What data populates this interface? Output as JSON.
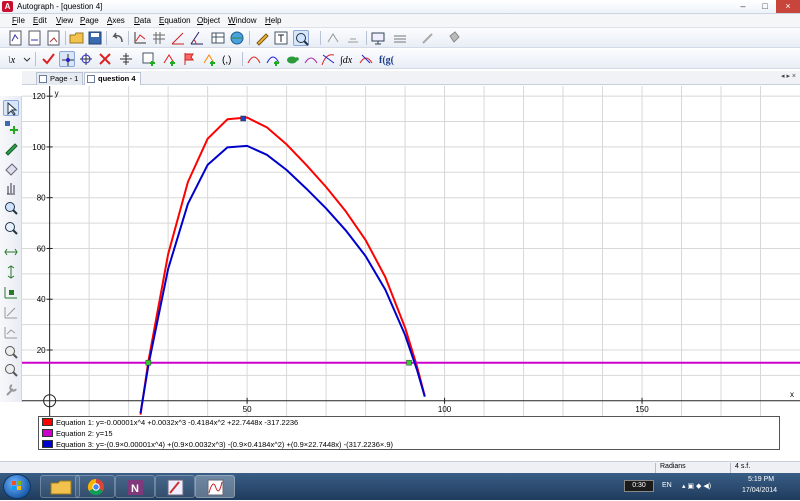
{
  "window": {
    "title": "Autograph - [question 4]"
  },
  "menu": [
    "File",
    "Edit",
    "View",
    "Page",
    "Axes",
    "Data",
    "Equation",
    "Object",
    "Window",
    "Help"
  ],
  "tabs": [
    {
      "label": "Page - 1",
      "active": false
    },
    {
      "label": "question 4",
      "active": true
    }
  ],
  "chart_data": {
    "type": "line",
    "xlabel": "x",
    "ylabel": "y",
    "xlim": [
      -7,
      190
    ],
    "ylim": [
      -6,
      124
    ],
    "x_ticks": [
      50,
      100,
      150
    ],
    "y_ticks": [
      20,
      40,
      60,
      80,
      100,
      120
    ],
    "grid": true,
    "series": [
      {
        "name": "Equation 1: y=-0.00001x^4 +0.0032x^3 -0.4184x^2 +22.7448x -317.2236",
        "color": "#ff0000",
        "x": [
          23.0,
          25.0,
          30.0,
          35.0,
          40.0,
          45.0,
          50.0,
          55.0,
          60.0,
          65.0,
          70.0,
          75.0,
          80.0,
          85.0,
          90.0,
          93.0,
          95.0
        ],
        "y": [
          -5.5,
          15.6,
          57.7,
          86.2,
          103.2,
          110.9,
          111.6,
          107.7,
          101.0,
          92.9,
          84.2,
          74.6,
          63.3,
          48.7,
          28.8,
          13.7,
          1.8
        ]
      },
      {
        "name": "Equation 2: y=15",
        "color": "#cc00cc",
        "x": [
          -7,
          190
        ],
        "y": [
          15,
          15
        ]
      },
      {
        "name": "Equation 3: y=-(0.9×0.00001x^4) +(0.9×0.0032x^3) -(0.9×0.4184x^2) +(0.9×22.7448x) -(317.2236×.9)",
        "color": "#0000cc",
        "x": [
          23.0,
          25.0,
          30.0,
          35.0,
          40.0,
          45.0,
          50.0,
          55.0,
          60.0,
          65.0,
          70.0,
          75.0,
          80.0,
          85.0,
          90.0,
          93.0,
          95.0
        ],
        "y": [
          -4.9,
          14.0,
          51.9,
          77.6,
          92.9,
          99.8,
          100.4,
          96.9,
          90.9,
          83.6,
          75.8,
          67.1,
          57.0,
          43.8,
          25.9,
          12.3,
          1.6
        ]
      }
    ],
    "points": [
      {
        "x": 49.0,
        "y": 111.2,
        "color": "#1f3fcc"
      },
      {
        "x": 25.0,
        "y": 15,
        "color": "#33cc33"
      },
      {
        "x": 91.0,
        "y": 15,
        "color": "#33cc33"
      }
    ]
  },
  "status": {
    "mode": "Radians",
    "sigfig": "4 s.f."
  },
  "taskbar": {
    "counter": "0:30",
    "lang": "EN",
    "time": "5:19 PM",
    "date": "17/04/2014"
  }
}
